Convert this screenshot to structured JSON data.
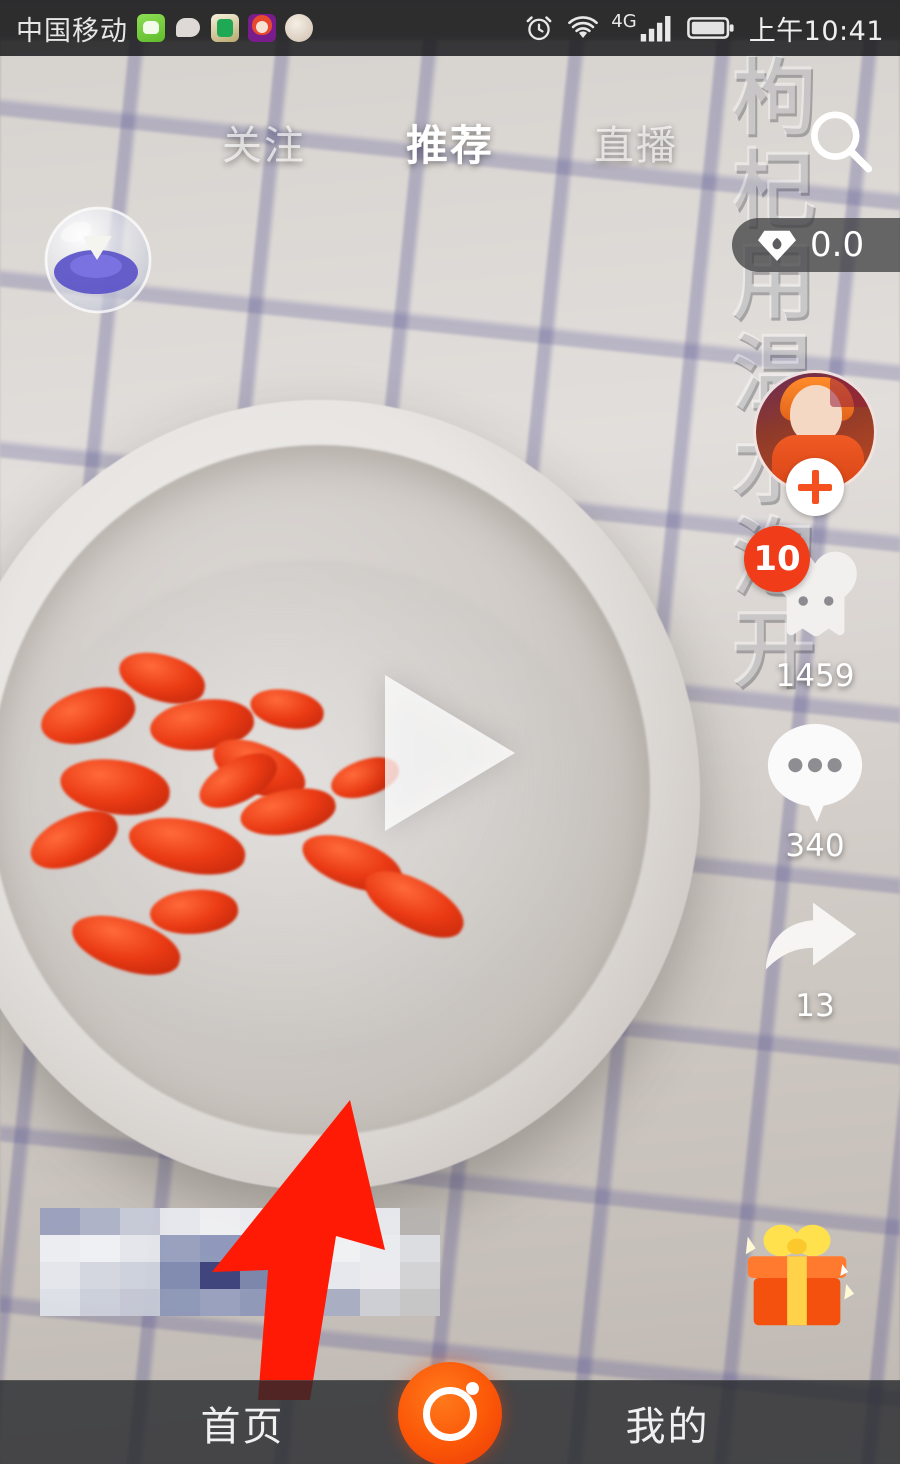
{
  "app": {
    "name": "short-video-feed",
    "accent_orange": "#f4511e",
    "badge_red": "#f03c18"
  },
  "status_bar": {
    "carrier": "中国移动",
    "time": "上午10:41",
    "network_type": "4G",
    "icons": [
      "wechat-icon",
      "chat-bubble-icon",
      "qq-icon",
      "avatar-app-icon",
      "egg-app-icon",
      "alarm-clock-icon",
      "wifi-icon",
      "signal-bars-icon",
      "battery-icon"
    ]
  },
  "top_nav": {
    "tabs": [
      {
        "label": "关注",
        "active": false
      },
      {
        "label": "推荐",
        "active": true
      },
      {
        "label": "直播",
        "active": false
      }
    ],
    "search_icon": "search-icon"
  },
  "hot_badge": {
    "icon": "diamond-flame-icon",
    "value": "0.0"
  },
  "watermark": {
    "text": "枸杞用温水泡开"
  },
  "right_rail": {
    "avatar": {
      "name": "avatar",
      "follow_icon": "plus-icon"
    },
    "like": {
      "icon": "heart-icon",
      "count": "1459",
      "badge": "10"
    },
    "comment": {
      "icon": "comment-bubble-icon",
      "count": "340"
    },
    "share": {
      "icon": "share-arrow-icon",
      "count": "13"
    },
    "gift": {
      "icon": "gift-box-icon"
    }
  },
  "player": {
    "play_icon": "play-triangle-icon",
    "state": "paused"
  },
  "overlay": {
    "top_left_icon": "diamond-ring-orb-icon",
    "annotation_arrow": "red-arrow-annotation",
    "annotation_arrow_color": "#ff1a06",
    "caption_state": "mosaic-censored"
  },
  "bottom_nav": {
    "home_label": "首页",
    "mine_label": "我的",
    "record_icon": "camera-record-icon"
  }
}
